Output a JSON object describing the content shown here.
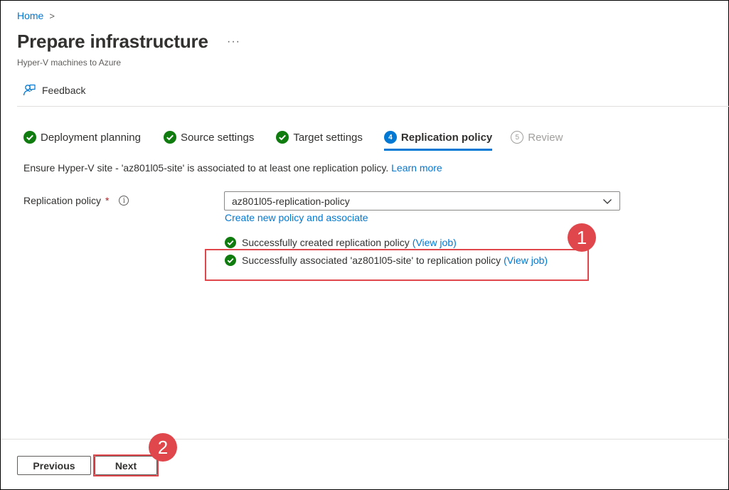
{
  "breadcrumb": {
    "home": "Home",
    "separator": ">"
  },
  "header": {
    "title": "Prepare infrastructure",
    "more": "···",
    "subtitle": "Hyper-V machines to Azure"
  },
  "toolbar": {
    "feedback_label": "Feedback",
    "feedback_icon": "feedback-icon"
  },
  "steps": [
    {
      "number": "1",
      "label": "Deployment planning",
      "state": "completed"
    },
    {
      "number": "2",
      "label": "Source settings",
      "state": "completed"
    },
    {
      "number": "3",
      "label": "Target settings",
      "state": "completed"
    },
    {
      "number": "4",
      "label": "Replication policy",
      "state": "active"
    },
    {
      "number": "5",
      "label": "Review",
      "state": "disabled"
    }
  ],
  "info": {
    "text": "Ensure Hyper-V site - 'az801l05-site' is associated to at least one replication policy.",
    "link": "Learn more"
  },
  "form": {
    "label": "Replication policy",
    "required_marker": "*",
    "info_icon": "i",
    "selected_value": "az801l05-replication-policy",
    "create_link": "Create new policy and associate"
  },
  "messages": [
    {
      "text": "Successfully created replication policy",
      "link": "(View job)"
    },
    {
      "text": "Successfully associated 'az801l05-site' to replication policy",
      "link": "(View job)"
    }
  ],
  "callouts": [
    "1",
    "2"
  ],
  "footer": {
    "previous": "Previous",
    "next": "Next"
  },
  "colors": {
    "accent": "#0078d4",
    "success": "#107c10",
    "highlight": "#e0474c",
    "text": "#323130"
  }
}
